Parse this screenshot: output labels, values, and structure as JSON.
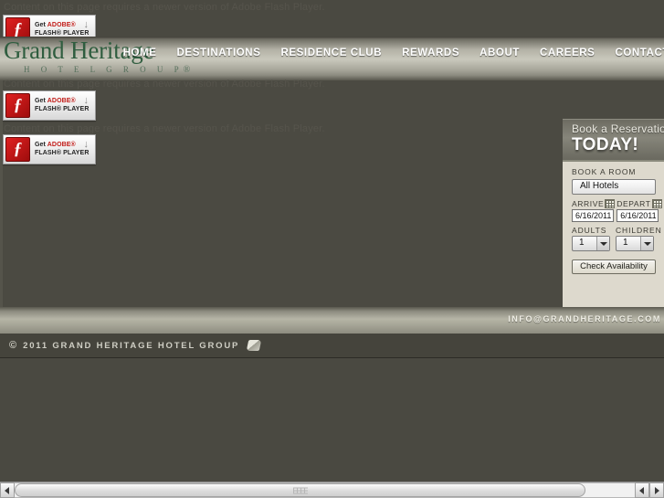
{
  "page": {
    "background_color": "#4a4941",
    "flash_notice": "Content on this page requires a newer version of Adobe Flash Player."
  },
  "flash_badge": {
    "line1_prefix": "Get ",
    "line1_brand": "ADOBE®",
    "line2": "FLASH® PLAYER",
    "download_arrow": "↓",
    "logo_glyph": "f"
  },
  "header": {
    "logo": {
      "main": "Grand Heritage",
      "sub": "H O T E L   G R O U P",
      "registered": "®",
      "color": "#2f5d3f"
    },
    "nav": [
      {
        "label": "HOME"
      },
      {
        "label": "DESTINATIONS"
      },
      {
        "label": "RESIDENCE CLUB"
      },
      {
        "label": "REWARDS"
      },
      {
        "label": "ABOUT"
      },
      {
        "label": "CAREERS"
      },
      {
        "label": "CONTACT"
      }
    ]
  },
  "booking": {
    "title": "Book a Reservation",
    "today": "TODAY!",
    "room_label": "BOOK A ROOM",
    "hotel_value": "All Hotels",
    "arrive_label": "ARRIVE",
    "depart_label": "DEPART",
    "arrive_value": "6/16/2011",
    "depart_value": "6/16/2011",
    "adults_label": "ADULTS",
    "children_label": "CHILDREN",
    "adults_value": "1",
    "children_value": "1",
    "submit_label": "Check Availability"
  },
  "footer": {
    "email": "INFO@GRANDHERITAGE.COM",
    "copyright_mark": "©",
    "copyright_text": "2011 GRAND HERITAGE HOTEL GROUP"
  },
  "scrollbar": {
    "left_arrow": "◀",
    "right_arrow": "▶"
  }
}
